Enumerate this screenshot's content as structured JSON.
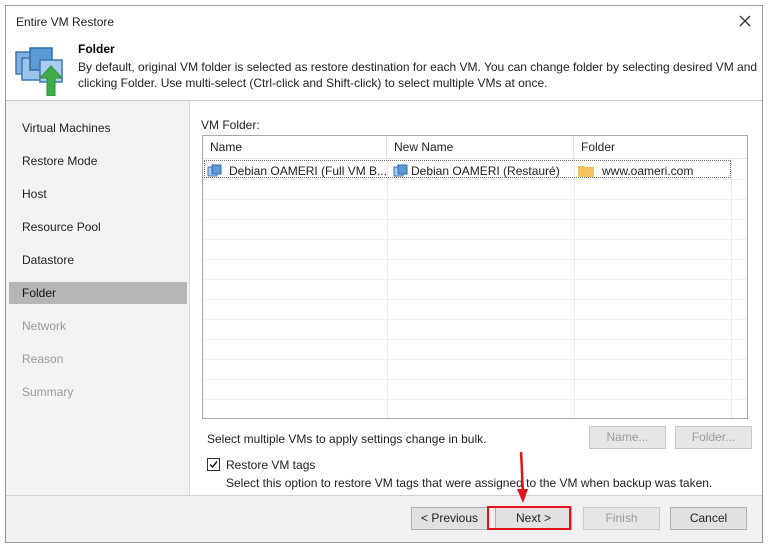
{
  "window": {
    "title": "Entire VM Restore"
  },
  "header": {
    "title": "Folder",
    "description": "By default, original VM folder is selected as restore destination for each VM. You can change folder by selecting desired VM and clicking Folder. Use multi-select (Ctrl-click and Shift-click) to select multiple VMs at once."
  },
  "steps": [
    {
      "label": "Virtual Machines",
      "state": "done"
    },
    {
      "label": "Restore Mode",
      "state": "done"
    },
    {
      "label": "Host",
      "state": "done"
    },
    {
      "label": "Resource Pool",
      "state": "done"
    },
    {
      "label": "Datastore",
      "state": "done"
    },
    {
      "label": "Folder",
      "state": "active"
    },
    {
      "label": "Network",
      "state": "disabled"
    },
    {
      "label": "Reason",
      "state": "disabled"
    },
    {
      "label": "Summary",
      "state": "disabled"
    }
  ],
  "content": {
    "vm_folder_label": "VM Folder:",
    "columns": [
      "Name",
      "New Name",
      "Folder"
    ],
    "rows": [
      {
        "name": "Debian OAMERI (Full VM B...",
        "new_name": "Debian OAMERI (Restauré)",
        "folder": "www.oameri.com"
      }
    ],
    "bulk_hint": "Select multiple VMs to apply settings change in bulk.",
    "name_button": "Name...",
    "folder_button": "Folder...",
    "restore_tags_label": "Restore VM tags",
    "restore_tags_checked": true,
    "restore_tags_desc": "Select this option to restore VM tags that were assigned to the VM when backup was taken."
  },
  "footer": {
    "previous": "< Previous",
    "next": "Next >",
    "finish": "Finish",
    "cancel": "Cancel"
  },
  "colors": {
    "highlight": "#e3141c",
    "active_step": "#b5b5b5",
    "folder_icon": "#f2c25c",
    "vm_icon": "#5b9bd5"
  }
}
